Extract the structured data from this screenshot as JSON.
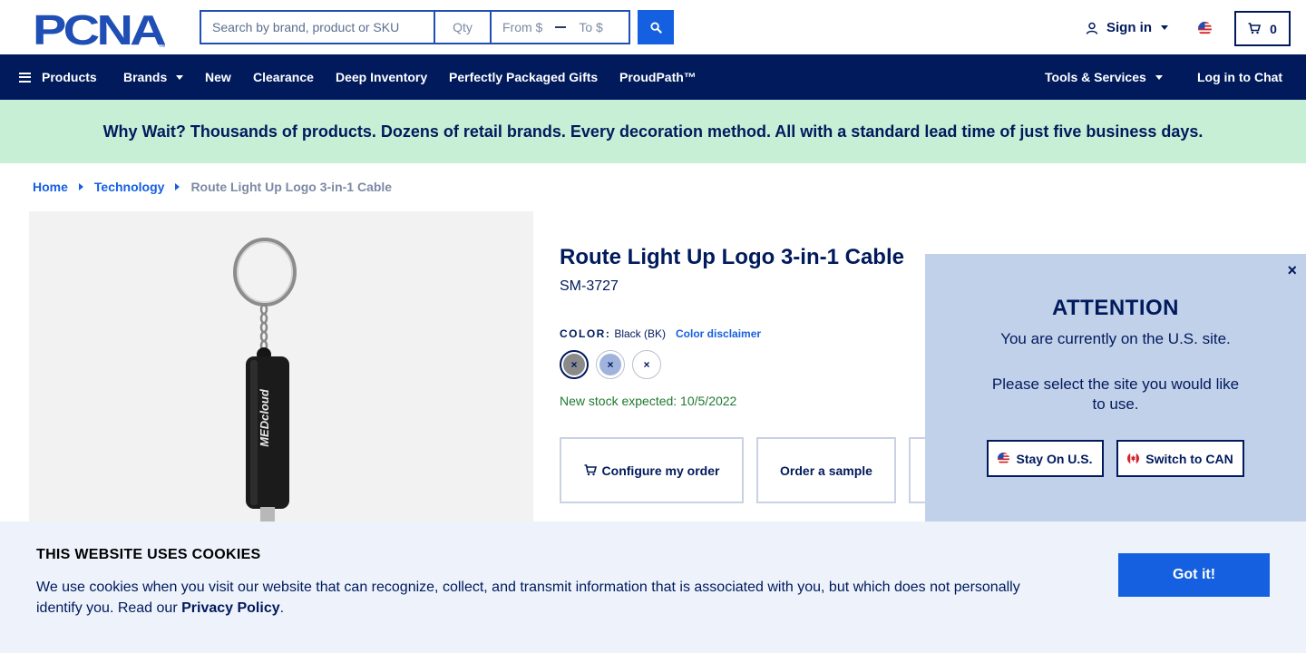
{
  "header": {
    "logo_text": "PCNA",
    "search_placeholder": "Search by brand, product or SKU",
    "qty_placeholder": "Qty",
    "price_from_placeholder": "From $",
    "price_to_placeholder": "To $",
    "sign_in": "Sign in",
    "cart_count": "0"
  },
  "nav": {
    "products": "Products",
    "brands": "Brands",
    "new": "New",
    "clearance": "Clearance",
    "deep_inventory": "Deep Inventory",
    "gifts": "Perfectly Packaged Gifts",
    "proudpath": "ProudPath™",
    "tools": "Tools & Services",
    "chat": "Log in to Chat"
  },
  "promo": {
    "text": "Why Wait? Thousands of products. Dozens of retail brands. Every decoration method. All with a standard lead time of just five business days."
  },
  "breadcrumb": {
    "home": "Home",
    "category": "Technology",
    "current": "Route Light Up Logo 3-in-1 Cable"
  },
  "product": {
    "title": "Route Light Up Logo 3-in-1 Cable",
    "sku": "SM-3727",
    "color_label": "COLOR:",
    "color_value": "Black (BK)",
    "color_disclaimer": "Color disclaimer",
    "stock_note": "New stock expected: 10/5/2022",
    "image_logo_text": "MEDcloud",
    "swatches": [
      {
        "name": "Black",
        "color": "#8a8a8a",
        "mark": "×"
      },
      {
        "name": "Blue",
        "color": "#9fb3dc",
        "mark": "×"
      },
      {
        "name": "White",
        "color": "#ffffff",
        "mark": "×"
      }
    ],
    "configure_label": "Configure my order",
    "sample_label": "Order a sample"
  },
  "attention": {
    "title": "ATTENTION",
    "message1": "You are currently on the U.S. site.",
    "message2": "Please select the site you would like to use.",
    "stay_label": "Stay On U.S.",
    "switch_label": "Switch to CAN",
    "close": "×"
  },
  "cookie": {
    "title": "THIS WEBSITE USES COOKIES",
    "text": "We use cookies when you visit our website that can recognize, collect, and transmit information that is associated with you, but which does not personally identify you. Read our ",
    "link": "Privacy Policy",
    "end": ".",
    "button": "Got it!"
  },
  "colors": {
    "navy": "#001a5c",
    "accent_blue": "#1560e0",
    "promo_green": "#c6efd6",
    "popup_bg": "#c2d1ea",
    "cookie_bg": "#edf2fb",
    "stock_green": "#1f7a2e"
  }
}
